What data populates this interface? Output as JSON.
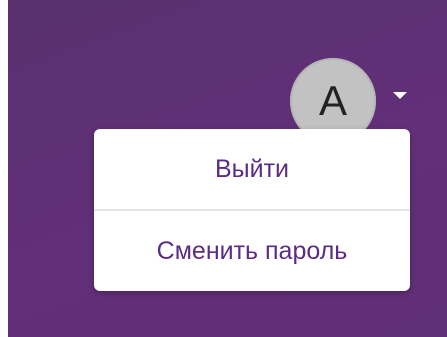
{
  "user_menu": {
    "avatar_initial": "A",
    "items": [
      {
        "label": "Выйти"
      },
      {
        "label": "Сменить пароль"
      }
    ]
  },
  "colors": {
    "header_bg": "#602f77",
    "avatar_bg": "#c2c2c2",
    "menu_text": "#5b2c86",
    "menu_bg": "#ffffff"
  },
  "icons": {
    "dropdown": "caret-down-icon"
  }
}
